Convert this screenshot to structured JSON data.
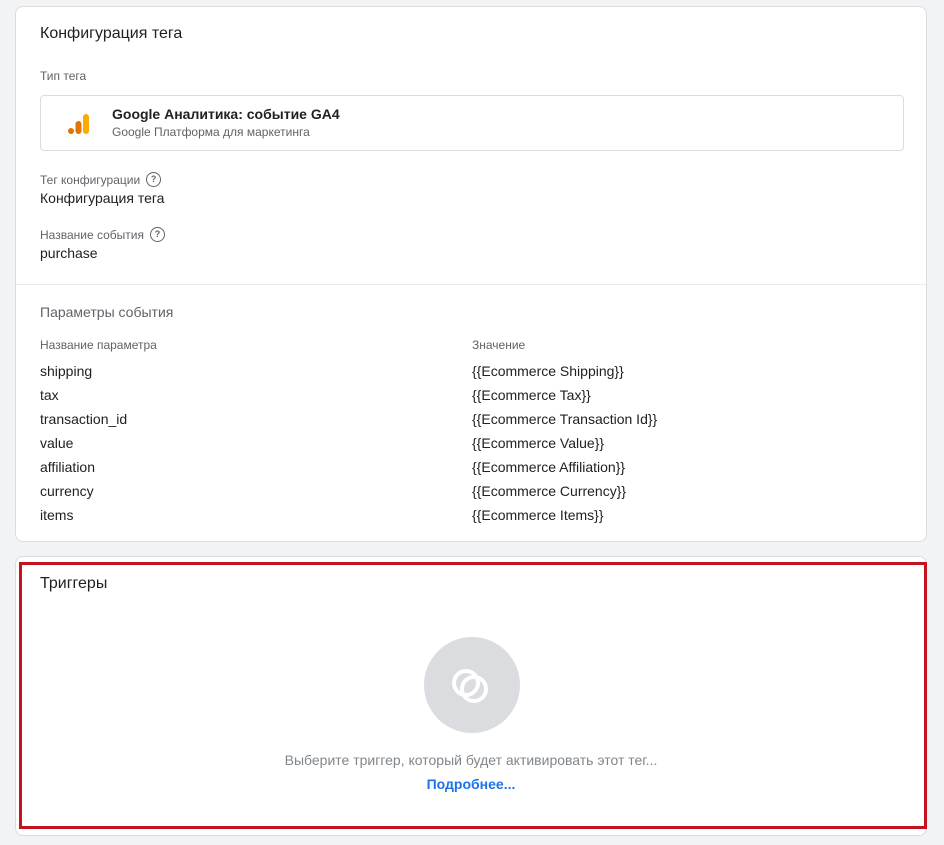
{
  "config_card": {
    "title": "Конфигурация тега",
    "tag_type_label": "Тип тега",
    "tag_type": {
      "name": "Google Аналитика: событие GA4",
      "platform": "Google Платформа для маркетинга",
      "icon": "google-analytics-icon"
    },
    "config_tag_label": "Тег конфигурации",
    "config_tag_value": "Конфигурация тега",
    "event_name_label": "Название события",
    "event_name_value": "purchase",
    "help_glyph": "?",
    "params_section_title": "Параметры события",
    "params_headers": {
      "name": "Название параметра",
      "value": "Значение"
    },
    "params": [
      {
        "name": "shipping",
        "value": "{{Ecommerce Shipping}}"
      },
      {
        "name": "tax",
        "value": "{{Ecommerce Tax}}"
      },
      {
        "name": "transaction_id",
        "value": "{{Ecommerce Transaction Id}}"
      },
      {
        "name": "value",
        "value": "{{Ecommerce Value}}"
      },
      {
        "name": "affiliation",
        "value": "{{Ecommerce Affiliation}}"
      },
      {
        "name": "currency",
        "value": "{{Ecommerce Currency}}"
      },
      {
        "name": "items",
        "value": "{{Ecommerce Items}}"
      }
    ]
  },
  "triggers_card": {
    "title": "Триггеры",
    "empty_text": "Выберите триггер, который будет активировать этот тег...",
    "learn_more": "Подробнее...",
    "icon": "trigger-placeholder-icon"
  },
  "colors": {
    "highlight_border": "#c5121f",
    "link": "#1a73e8",
    "ga_orange": "#f9ab00",
    "ga_dark_orange": "#e37400"
  }
}
